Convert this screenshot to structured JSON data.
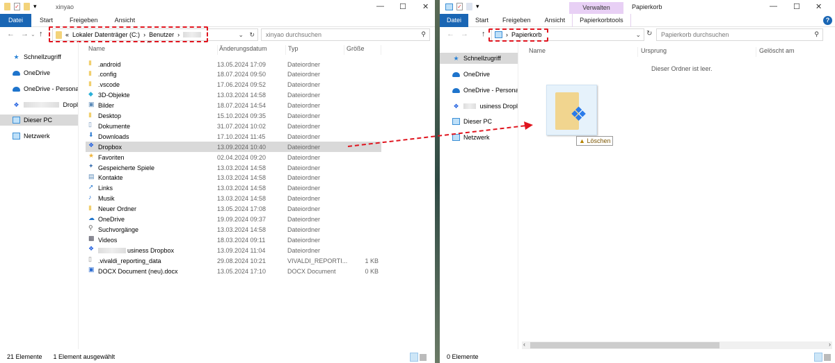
{
  "left": {
    "title": "xinyao",
    "tabs": [
      "Datei",
      "Start",
      "Freigeben",
      "Ansicht"
    ],
    "breadcrumb": [
      "Lokaler Datenträger (C:)",
      "Benutzer"
    ],
    "breadcrumb_prefix": "«",
    "search_placeholder": "xinyao durchsuchen",
    "nav": [
      {
        "label": "Schnellzugriff",
        "icon": "star-icon"
      },
      {
        "label": "OneDrive",
        "icon": "cloud-icon"
      },
      {
        "label": "OneDrive - Personal",
        "icon": "cloud-icon"
      },
      {
        "label": "Dropl",
        "icon": "dropbox-icon"
      },
      {
        "label": "Dieser PC",
        "icon": "pc-icon"
      },
      {
        "label": "Netzwerk",
        "icon": "network-icon"
      }
    ],
    "columns": [
      "Name",
      "Änderungsdatum",
      "Typ",
      "Größe"
    ],
    "rows": [
      {
        "name": ".android",
        "date": "13.05.2024 17:09",
        "type": "Dateiordner",
        "size": "",
        "icon": "folder"
      },
      {
        "name": ".config",
        "date": "18.07.2024 09:50",
        "type": "Dateiordner",
        "size": "",
        "icon": "folder"
      },
      {
        "name": ".vscode",
        "date": "17.06.2024 09:52",
        "type": "Dateiordner",
        "size": "",
        "icon": "folder"
      },
      {
        "name": "3D-Objekte",
        "date": "13.03.2024 14:58",
        "type": "Dateiordner",
        "size": "",
        "icon": "cube"
      },
      {
        "name": "Bilder",
        "date": "18.07.2024 14:54",
        "type": "Dateiordner",
        "size": "",
        "icon": "picture"
      },
      {
        "name": "Desktop",
        "date": "15.10.2024 09:35",
        "type": "Dateiordner",
        "size": "",
        "icon": "folder"
      },
      {
        "name": "Dokumente",
        "date": "31.07.2024 10:02",
        "type": "Dateiordner",
        "size": "",
        "icon": "document"
      },
      {
        "name": "Downloads",
        "date": "17.10.2024 11:45",
        "type": "Dateiordner",
        "size": "",
        "icon": "download"
      },
      {
        "name": "Dropbox",
        "date": "13.09.2024 10:40",
        "type": "Dateiordner",
        "size": "",
        "icon": "dropbox",
        "selected": true
      },
      {
        "name": "Favoriten",
        "date": "02.04.2024 09:20",
        "type": "Dateiordner",
        "size": "",
        "icon": "star"
      },
      {
        "name": "Gespeicherte Spiele",
        "date": "13.03.2024 14:58",
        "type": "Dateiordner",
        "size": "",
        "icon": "game"
      },
      {
        "name": "Kontakte",
        "date": "13.03.2024 14:58",
        "type": "Dateiordner",
        "size": "",
        "icon": "contacts"
      },
      {
        "name": "Links",
        "date": "13.03.2024 14:58",
        "type": "Dateiordner",
        "size": "",
        "icon": "link"
      },
      {
        "name": "Musik",
        "date": "13.03.2024 14:58",
        "type": "Dateiordner",
        "size": "",
        "icon": "music"
      },
      {
        "name": "Neuer Ordner",
        "date": "13.05.2024 17:08",
        "type": "Dateiordner",
        "size": "",
        "icon": "folder"
      },
      {
        "name": "OneDrive",
        "date": "19.09.2024 09:37",
        "type": "Dateiordner",
        "size": "",
        "icon": "cloud"
      },
      {
        "name": "Suchvorgänge",
        "date": "13.03.2024 14:58",
        "type": "Dateiordner",
        "size": "",
        "icon": "search"
      },
      {
        "name": "Videos",
        "date": "18.03.2024 09:11",
        "type": "Dateiordner",
        "size": "",
        "icon": "video"
      },
      {
        "name": "usiness Dropbox",
        "date": "13.09.2024 11:04",
        "type": "Dateiordner",
        "size": "",
        "icon": "dropbox"
      },
      {
        "name": ".vivaldi_reporting_data",
        "date": "29.08.2024 10:21",
        "type": "VIVALDI_REPORTI...",
        "size": "1 KB",
        "icon": "file"
      },
      {
        "name": "DOCX Document (neu).docx",
        "date": "13.05.2024 17:10",
        "type": "DOCX Document",
        "size": "0 KB",
        "icon": "docx"
      }
    ],
    "status_count": "21 Elemente",
    "status_selected": "1 Element ausgewählt"
  },
  "right": {
    "title": "Papierkorb",
    "context_tab": "Verwalten",
    "context_subtab": "Papierkorbtools",
    "tabs": [
      "Datei",
      "Start",
      "Freigeben",
      "Ansicht"
    ],
    "breadcrumb": [
      "Papierkorb"
    ],
    "search_placeholder": "Papierkorb durchsuchen",
    "nav": [
      {
        "label": "Schnellzugriff"
      },
      {
        "label": "OneDrive"
      },
      {
        "label": "OneDrive - Personal"
      },
      {
        "label": "usiness Dropl"
      },
      {
        "label": "Dieser PC"
      },
      {
        "label": "Netzwerk"
      }
    ],
    "columns": [
      "Name",
      "Ursprung",
      "Gelöscht am"
    ],
    "empty_text": "Dieser Ordner ist leer.",
    "drag_tooltip": "Löschen",
    "status_count": "0 Elemente"
  },
  "colors": {
    "file_tab": "#1a66b4",
    "context_tab": "#e8d0f5",
    "annotation": "#e0141e",
    "selection": "#d9d9d9"
  }
}
